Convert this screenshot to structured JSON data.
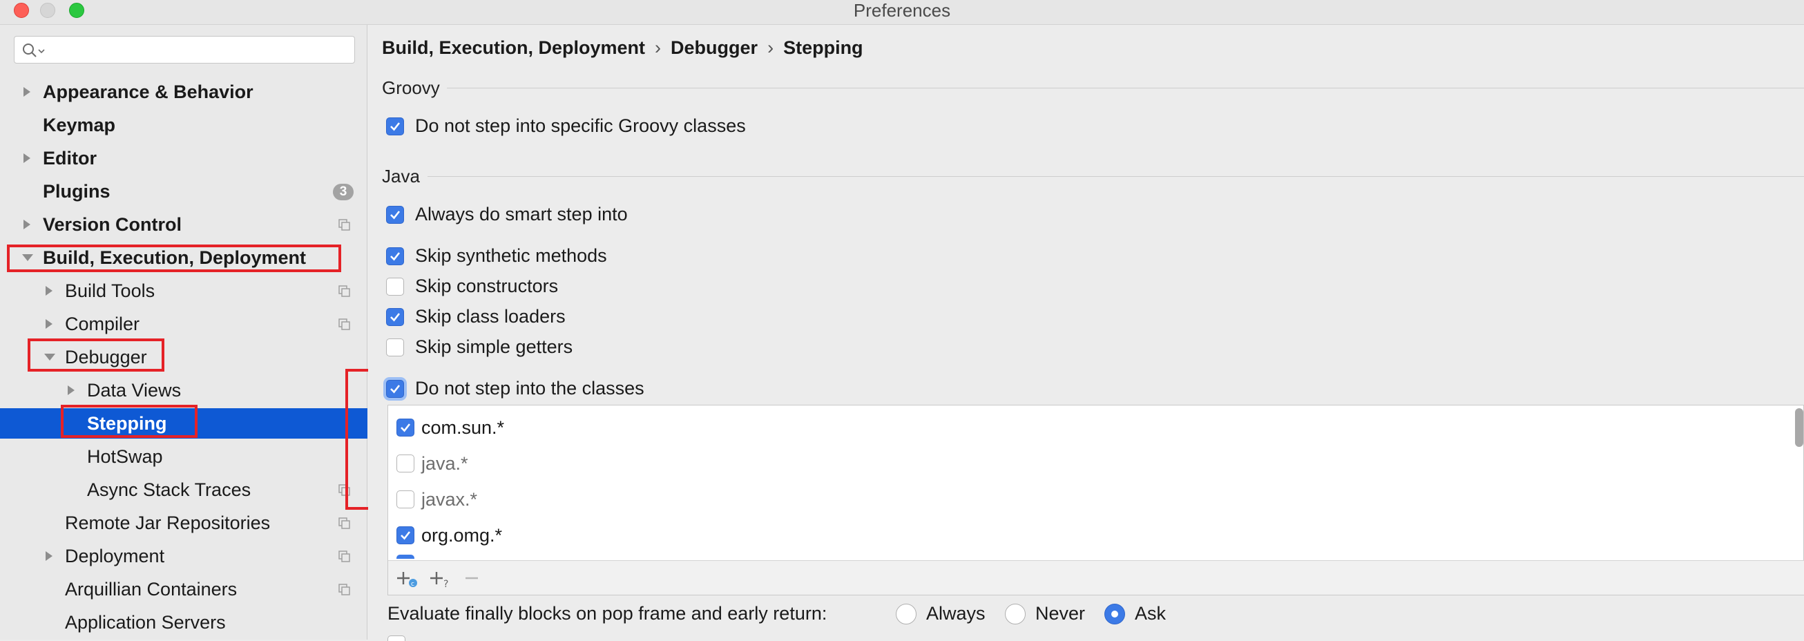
{
  "window": {
    "title": "Preferences"
  },
  "search": {
    "placeholder": ""
  },
  "sidebar": {
    "items": [
      {
        "label": "Appearance & Behavior",
        "bold": true,
        "arrow": "right"
      },
      {
        "label": "Keymap",
        "bold": true
      },
      {
        "label": "Editor",
        "bold": true,
        "arrow": "right"
      },
      {
        "label": "Plugins",
        "bold": true,
        "badge": "3"
      },
      {
        "label": "Version Control",
        "bold": true,
        "arrow": "right"
      },
      {
        "label": "Build, Execution, Deployment",
        "bold": true,
        "arrow": "down"
      },
      {
        "label": "Build Tools",
        "arrow": "right"
      },
      {
        "label": "Compiler",
        "arrow": "right"
      },
      {
        "label": "Debugger",
        "arrow": "down"
      },
      {
        "label": "Data Views",
        "arrow": "right"
      },
      {
        "label": "Stepping",
        "selected": true
      },
      {
        "label": "HotSwap"
      },
      {
        "label": "Async Stack Traces"
      },
      {
        "label": "Remote Jar Repositories"
      },
      {
        "label": "Deployment",
        "arrow": "right"
      },
      {
        "label": "Arquillian Containers"
      },
      {
        "label": "Application Servers"
      }
    ]
  },
  "breadcrumb": {
    "part1": "Build, Execution, Deployment",
    "part2": "Debugger",
    "part3": "Stepping",
    "sep": "›"
  },
  "groovy": {
    "title": "Groovy",
    "options": [
      {
        "label": "Do not step into specific Groovy classes",
        "checked": true
      }
    ]
  },
  "java": {
    "title": "Java",
    "options": [
      {
        "label": "Always do smart step into",
        "checked": true
      },
      {
        "label": "Skip synthetic methods",
        "checked": true
      },
      {
        "label": "Skip constructors",
        "checked": false
      },
      {
        "label": "Skip class loaders",
        "checked": true
      },
      {
        "label": "Skip simple getters",
        "checked": false
      },
      {
        "label": "Do not step into the classes",
        "checked": true
      }
    ]
  },
  "class_list": {
    "rows": [
      {
        "label": "com.sun.*",
        "checked": true
      },
      {
        "label": "java.*",
        "checked": false
      },
      {
        "label": "javax.*",
        "checked": false
      },
      {
        "label": "org.omg.*",
        "checked": true
      }
    ]
  },
  "finally": {
    "question": "Evaluate finally blocks on pop frame and early return:",
    "options": [
      "Always",
      "Never",
      "Ask"
    ],
    "selected": "Ask"
  },
  "colors": {
    "accent": "#3c7ae6",
    "selection": "#0e59d4",
    "highlight_box": "#e52227"
  }
}
